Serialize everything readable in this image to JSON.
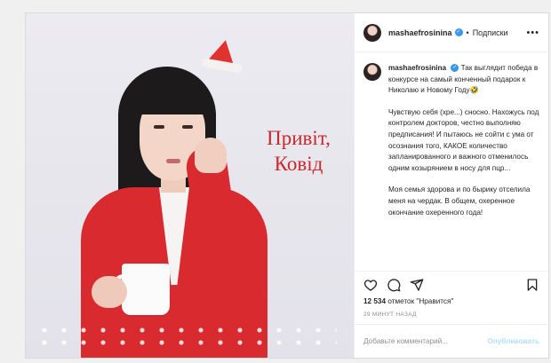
{
  "post": {
    "photo_caption_line1": "Привіт,",
    "photo_caption_line2": "Ковід"
  },
  "header": {
    "username": "mashaefrosinina",
    "separator": "•",
    "follow_label": "Подписки",
    "more_label": "•••"
  },
  "comment": {
    "username": "mashaefrosinina",
    "p1": "Так выглядит победа в конкурсе на самый конченный подарок к Николаю и Новому Году🤣",
    "p2": "Чувствую себя (хре...) сносно. Нахожусь под контролем докторов, честно выполняю предписания! И пытаюсь не сойти с ума от осознания того, КАКОЕ количество запланированного и важного отменилось одним козырянием в носу для пцр...",
    "p3": "Моя семья здорова и по бырику отселила меня на чердак. В общем, охеренное окончание охеренного года!"
  },
  "icons": {
    "like": "heart-icon",
    "comment": "comment-icon",
    "share": "share-icon",
    "save": "bookmark-icon",
    "verified": "verified-badge-icon"
  },
  "likes": {
    "count": "12 534",
    "text": "отметок \"Нравится\""
  },
  "timestamp": "29 минут назад",
  "add_comment": {
    "placeholder": "Добавьте комментарий...",
    "publish_label": "Опубликовать"
  },
  "colors": {
    "caption_red": "#c9292d",
    "verified_blue": "#3897f0",
    "publish_disabled": "#b2dffc"
  }
}
